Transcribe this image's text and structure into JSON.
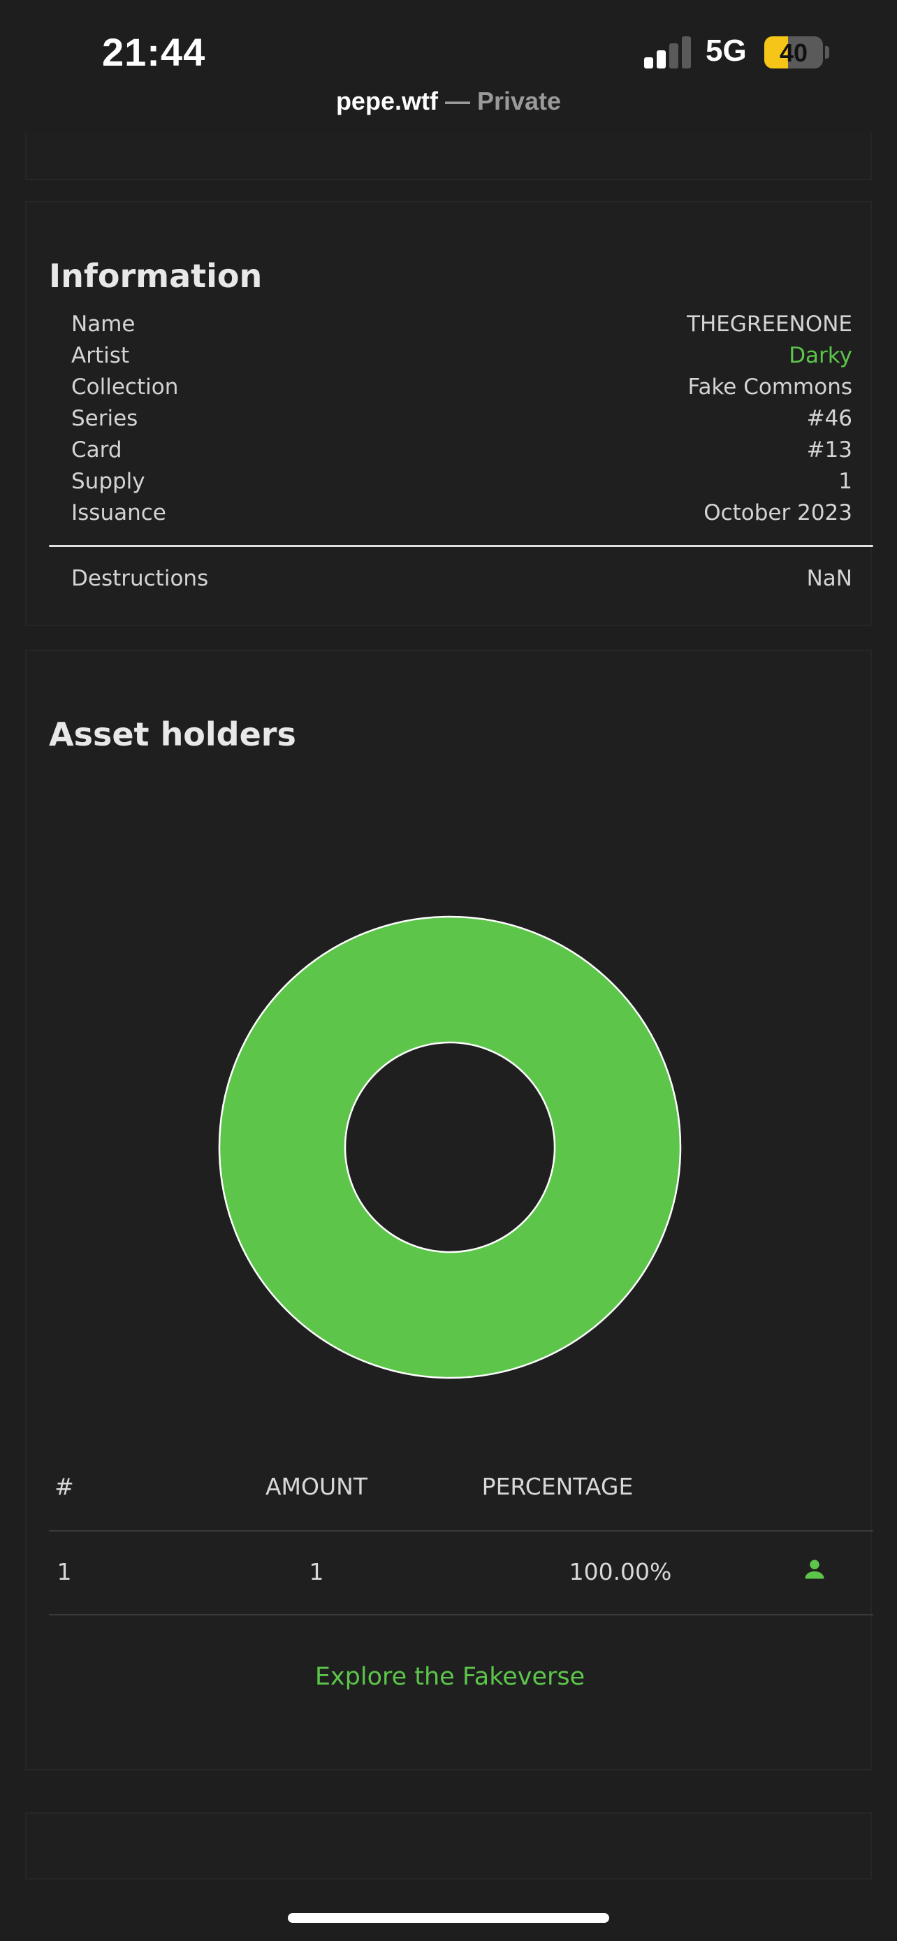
{
  "status_bar": {
    "time": "21:44",
    "network": "5G",
    "battery_percent": "40",
    "battery_level": 0.4,
    "signal_bars_active": 2,
    "signal_bars_total": 4,
    "url_domain": "pepe.wtf",
    "url_separator": "—",
    "url_mode": "Private"
  },
  "information": {
    "title": "Information",
    "rows": [
      {
        "label": "Name",
        "value": "THEGREENONE",
        "link": false
      },
      {
        "label": "Artist",
        "value": "Darky",
        "link": true
      },
      {
        "label": "Collection",
        "value": "Fake Commons",
        "link": false
      },
      {
        "label": "Series",
        "value": "#46",
        "link": false
      },
      {
        "label": "Card",
        "value": "#13",
        "link": false
      },
      {
        "label": "Supply",
        "value": "1",
        "link": false
      },
      {
        "label": "Issuance",
        "value": "October 2023",
        "link": false
      }
    ],
    "destructions": {
      "label": "Destructions",
      "value": "NaN"
    }
  },
  "holders": {
    "title": "Asset holders",
    "table": {
      "headers": [
        "#",
        "AMOUNT",
        "PERCENTAGE"
      ],
      "rows": [
        {
          "rank": "1",
          "amount": "1",
          "percentage": "100.00%",
          "icon": "user-icon"
        }
      ]
    },
    "explore_link": "Explore the Fakeverse"
  },
  "chart_data": {
    "type": "pie",
    "donut": true,
    "slices": [
      {
        "value": 100,
        "color": "#5cc54a"
      }
    ]
  },
  "colors": {
    "accent": "#5cc54a",
    "background": "#1e1e1e",
    "battery": "#f5c518"
  }
}
